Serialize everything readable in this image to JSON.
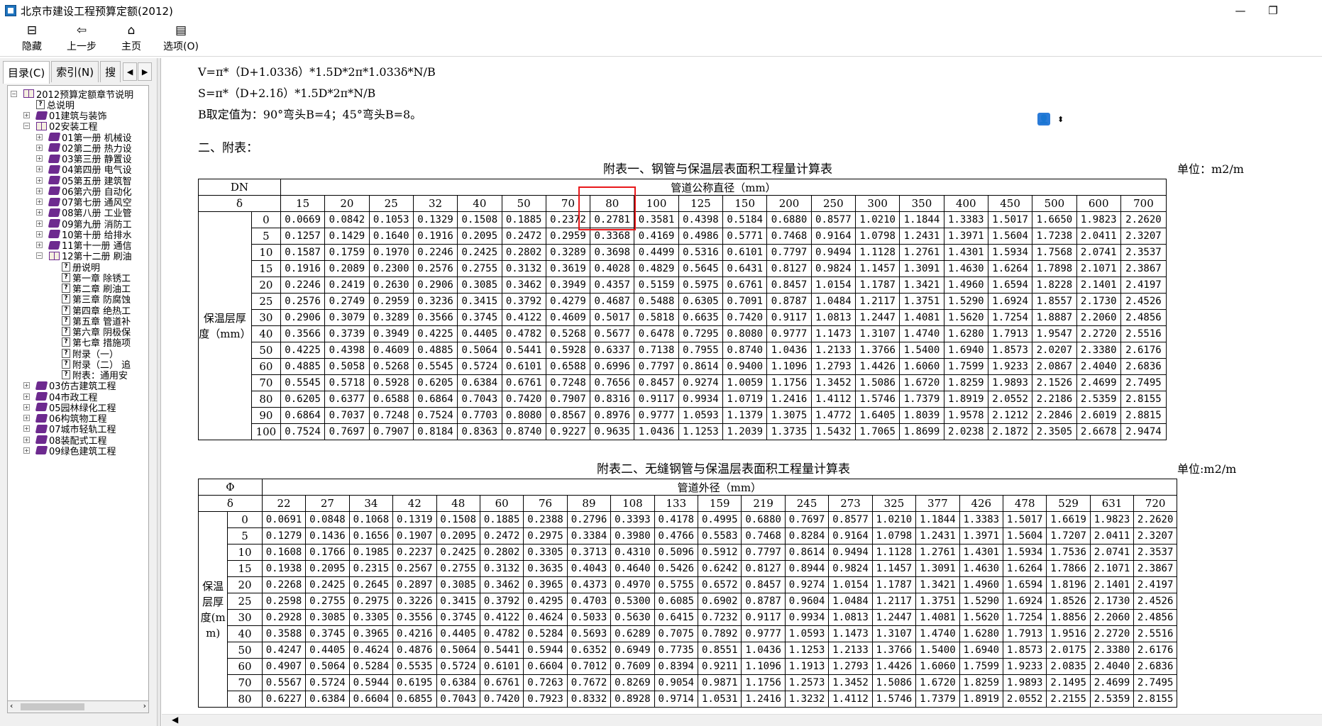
{
  "window": {
    "title": "北京市建设工程预算定额(2012)",
    "min": "—",
    "max": "❐"
  },
  "toolbar": {
    "hide": "隐藏",
    "back": "上一步",
    "home": "主页",
    "options": "选项(O)"
  },
  "tabs": {
    "contents": "目录(C)",
    "index": "索引(N)",
    "search": "搜",
    "prev": "◀",
    "next": "▶"
  },
  "tree": [
    {
      "label": "2012预算定额章节说明",
      "indent": 0,
      "exp": "−",
      "icon": "open"
    },
    {
      "label": "总说明",
      "indent": 1,
      "exp": "",
      "icon": "help"
    },
    {
      "label": "01建筑与装饰",
      "indent": 1,
      "exp": "+",
      "icon": "closed"
    },
    {
      "label": "02安装工程",
      "indent": 1,
      "exp": "−",
      "icon": "open"
    },
    {
      "label": "01第一册 机械设",
      "indent": 2,
      "exp": "+",
      "icon": "closed"
    },
    {
      "label": "02第二册 热力设",
      "indent": 2,
      "exp": "+",
      "icon": "closed"
    },
    {
      "label": "03第三册 静置设",
      "indent": 2,
      "exp": "+",
      "icon": "closed"
    },
    {
      "label": "04第四册 电气设",
      "indent": 2,
      "exp": "+",
      "icon": "closed"
    },
    {
      "label": "05第五册 建筑智",
      "indent": 2,
      "exp": "+",
      "icon": "closed"
    },
    {
      "label": "06第六册 自动化",
      "indent": 2,
      "exp": "+",
      "icon": "closed"
    },
    {
      "label": "07第七册 通风空",
      "indent": 2,
      "exp": "+",
      "icon": "closed"
    },
    {
      "label": "08第八册 工业管",
      "indent": 2,
      "exp": "+",
      "icon": "closed"
    },
    {
      "label": "09第九册 消防工",
      "indent": 2,
      "exp": "+",
      "icon": "closed"
    },
    {
      "label": "10第十册 给排水",
      "indent": 2,
      "exp": "+",
      "icon": "closed"
    },
    {
      "label": "11第十一册 通信",
      "indent": 2,
      "exp": "+",
      "icon": "closed"
    },
    {
      "label": "12第十二册 刷油",
      "indent": 2,
      "exp": "−",
      "icon": "open"
    },
    {
      "label": "册说明",
      "indent": 3,
      "exp": "",
      "icon": "help"
    },
    {
      "label": "第一章 除锈工",
      "indent": 3,
      "exp": "",
      "icon": "help"
    },
    {
      "label": "第二章 刷油工",
      "indent": 3,
      "exp": "",
      "icon": "help"
    },
    {
      "label": "第三章 防腐蚀",
      "indent": 3,
      "exp": "",
      "icon": "help"
    },
    {
      "label": "第四章 绝热工",
      "indent": 3,
      "exp": "",
      "icon": "help"
    },
    {
      "label": "第五章 管道补",
      "indent": 3,
      "exp": "",
      "icon": "help"
    },
    {
      "label": "第六章 阴极保",
      "indent": 3,
      "exp": "",
      "icon": "help"
    },
    {
      "label": "第七章 措施项",
      "indent": 3,
      "exp": "",
      "icon": "help"
    },
    {
      "label": "附录（一）",
      "indent": 3,
      "exp": "",
      "icon": "help"
    },
    {
      "label": "附录（二） 追",
      "indent": 3,
      "exp": "",
      "icon": "help"
    },
    {
      "label": "附表：通用安",
      "indent": 3,
      "exp": "",
      "icon": "help"
    },
    {
      "label": "03仿古建筑工程",
      "indent": 1,
      "exp": "+",
      "icon": "closed"
    },
    {
      "label": "04市政工程",
      "indent": 1,
      "exp": "+",
      "icon": "closed"
    },
    {
      "label": "05园林绿化工程",
      "indent": 1,
      "exp": "+",
      "icon": "closed"
    },
    {
      "label": "06构筑物工程",
      "indent": 1,
      "exp": "+",
      "icon": "closed"
    },
    {
      "label": "07城市轻轨工程",
      "indent": 1,
      "exp": "+",
      "icon": "closed"
    },
    {
      "label": "08装配式工程",
      "indent": 1,
      "exp": "+",
      "icon": "closed"
    },
    {
      "label": "09绿色建筑工程",
      "indent": 1,
      "exp": "+",
      "icon": "closed"
    }
  ],
  "content": {
    "formula_v": "V=π*（D+1.033δ）*1.5D*2π*1.033δ*N/B",
    "formula_s": "S=π*（D+2.1δ）*1.5D*2π*N/B",
    "formula_b": "B取定值为：90°弯头B=4；45°弯头B=8。",
    "section": "二、附表："
  },
  "table1": {
    "title": "附表一、钢管与保温层表面积工程量计算表",
    "unit": "单位：m2/m",
    "corner_top": "DN",
    "corner_bottom": "δ",
    "span_header": "管道公称直径（mm）",
    "row_label": "保温层厚度（mm）",
    "columns": [
      "15",
      "20",
      "25",
      "32",
      "40",
      "50",
      "70",
      "80",
      "100",
      "125",
      "150",
      "200",
      "250",
      "300",
      "350",
      "400",
      "450",
      "500",
      "600",
      "700"
    ],
    "rows": [
      {
        "d": "0",
        "v": [
          "0.0669",
          "0.0842",
          "0.1053",
          "0.1329",
          "0.1508",
          "0.1885",
          "0.2372",
          "0.2781",
          "0.3581",
          "0.4398",
          "0.5184",
          "0.6880",
          "0.8577",
          "1.0210",
          "1.1844",
          "1.3383",
          "1.5017",
          "1.6650",
          "1.9823",
          "2.2620"
        ]
      },
      {
        "d": "5",
        "v": [
          "0.1257",
          "0.1429",
          "0.1640",
          "0.1916",
          "0.2095",
          "0.2472",
          "0.2959",
          "0.3368",
          "0.4169",
          "0.4986",
          "0.5771",
          "0.7468",
          "0.9164",
          "1.0798",
          "1.2431",
          "1.3971",
          "1.5604",
          "1.7238",
          "2.0411",
          "2.3207"
        ]
      },
      {
        "d": "10",
        "v": [
          "0.1587",
          "0.1759",
          "0.1970",
          "0.2246",
          "0.2425",
          "0.2802",
          "0.3289",
          "0.3698",
          "0.4499",
          "0.5316",
          "0.6101",
          "0.7797",
          "0.9494",
          "1.1128",
          "1.2761",
          "1.4301",
          "1.5934",
          "1.7568",
          "2.0741",
          "2.3537"
        ]
      },
      {
        "d": "15",
        "v": [
          "0.1916",
          "0.2089",
          "0.2300",
          "0.2576",
          "0.2755",
          "0.3132",
          "0.3619",
          "0.4028",
          "0.4829",
          "0.5645",
          "0.6431",
          "0.8127",
          "0.9824",
          "1.1457",
          "1.3091",
          "1.4630",
          "1.6264",
          "1.7898",
          "2.1071",
          "2.3867"
        ]
      },
      {
        "d": "20",
        "v": [
          "0.2246",
          "0.2419",
          "0.2630",
          "0.2906",
          "0.3085",
          "0.3462",
          "0.3949",
          "0.4357",
          "0.5159",
          "0.5975",
          "0.6761",
          "0.8457",
          "1.0154",
          "1.1787",
          "1.3421",
          "1.4960",
          "1.6594",
          "1.8228",
          "2.1401",
          "2.4197"
        ]
      },
      {
        "d": "25",
        "v": [
          "0.2576",
          "0.2749",
          "0.2959",
          "0.3236",
          "0.3415",
          "0.3792",
          "0.4279",
          "0.4687",
          "0.5488",
          "0.6305",
          "0.7091",
          "0.8787",
          "1.0484",
          "1.2117",
          "1.3751",
          "1.5290",
          "1.6924",
          "1.8557",
          "2.1730",
          "2.4526"
        ]
      },
      {
        "d": "30",
        "v": [
          "0.2906",
          "0.3079",
          "0.3289",
          "0.3566",
          "0.3745",
          "0.4122",
          "0.4609",
          "0.5017",
          "0.5818",
          "0.6635",
          "0.7420",
          "0.9117",
          "1.0813",
          "1.2447",
          "1.4081",
          "1.5620",
          "1.7254",
          "1.8887",
          "2.2060",
          "2.4856"
        ]
      },
      {
        "d": "40",
        "v": [
          "0.3566",
          "0.3739",
          "0.3949",
          "0.4225",
          "0.4405",
          "0.4782",
          "0.5268",
          "0.5677",
          "0.6478",
          "0.7295",
          "0.8080",
          "0.9777",
          "1.1473",
          "1.3107",
          "1.4740",
          "1.6280",
          "1.7913",
          "1.9547",
          "2.2720",
          "2.5516"
        ]
      },
      {
        "d": "50",
        "v": [
          "0.4225",
          "0.4398",
          "0.4609",
          "0.4885",
          "0.5064",
          "0.5441",
          "0.5928",
          "0.6337",
          "0.7138",
          "0.7955",
          "0.8740",
          "1.0436",
          "1.2133",
          "1.3766",
          "1.5400",
          "1.6940",
          "1.8573",
          "2.0207",
          "2.3380",
          "2.6176"
        ]
      },
      {
        "d": "60",
        "v": [
          "0.4885",
          "0.5058",
          "0.5268",
          "0.5545",
          "0.5724",
          "0.6101",
          "0.6588",
          "0.6996",
          "0.7797",
          "0.8614",
          "0.9400",
          "1.1096",
          "1.2793",
          "1.4426",
          "1.6060",
          "1.7599",
          "1.9233",
          "2.0867",
          "2.4040",
          "2.6836"
        ]
      },
      {
        "d": "70",
        "v": [
          "0.5545",
          "0.5718",
          "0.5928",
          "0.6205",
          "0.6384",
          "0.6761",
          "0.7248",
          "0.7656",
          "0.8457",
          "0.9274",
          "1.0059",
          "1.1756",
          "1.3452",
          "1.5086",
          "1.6720",
          "1.8259",
          "1.9893",
          "2.1526",
          "2.4699",
          "2.7495"
        ]
      },
      {
        "d": "80",
        "v": [
          "0.6205",
          "0.6377",
          "0.6588",
          "0.6864",
          "0.7043",
          "0.7420",
          "0.7907",
          "0.8316",
          "0.9117",
          "0.9934",
          "1.0719",
          "1.2416",
          "1.4112",
          "1.5746",
          "1.7379",
          "1.8919",
          "2.0552",
          "2.2186",
          "2.5359",
          "2.8155"
        ]
      },
      {
        "d": "90",
        "v": [
          "0.6864",
          "0.7037",
          "0.7248",
          "0.7524",
          "0.7703",
          "0.8080",
          "0.8567",
          "0.8976",
          "0.9777",
          "1.0593",
          "1.1379",
          "1.3075",
          "1.4772",
          "1.6405",
          "1.8039",
          "1.9578",
          "2.1212",
          "2.2846",
          "2.6019",
          "2.8815"
        ]
      },
      {
        "d": "100",
        "v": [
          "0.7524",
          "0.7697",
          "0.7907",
          "0.8184",
          "0.8363",
          "0.8740",
          "0.9227",
          "0.9635",
          "1.0436",
          "1.1253",
          "1.2039",
          "1.3735",
          "1.5432",
          "1.7065",
          "1.8699",
          "2.0238",
          "2.1872",
          "2.3505",
          "2.6678",
          "2.9474"
        ]
      }
    ]
  },
  "table2": {
    "title": "附表二、无缝钢管与保温层表面积工程量计算表",
    "unit": "单位:m2/m",
    "corner_top": "Φ",
    "corner_bottom": "δ",
    "span_header": "管道外径（mm）",
    "row_label": "保温层厚度(mm)",
    "columns": [
      "22",
      "27",
      "34",
      "42",
      "48",
      "60",
      "76",
      "89",
      "108",
      "133",
      "159",
      "219",
      "245",
      "273",
      "325",
      "377",
      "426",
      "478",
      "529",
      "631",
      "720"
    ],
    "rows": [
      {
        "d": "0",
        "v": [
          "0.0691",
          "0.0848",
          "0.1068",
          "0.1319",
          "0.1508",
          "0.1885",
          "0.2388",
          "0.2796",
          "0.3393",
          "0.4178",
          "0.4995",
          "0.6880",
          "0.7697",
          "0.8577",
          "1.0210",
          "1.1844",
          "1.3383",
          "1.5017",
          "1.6619",
          "1.9823",
          "2.2620"
        ]
      },
      {
        "d": "5",
        "v": [
          "0.1279",
          "0.1436",
          "0.1656",
          "0.1907",
          "0.2095",
          "0.2472",
          "0.2975",
          "0.3384",
          "0.3980",
          "0.4766",
          "0.5583",
          "0.7468",
          "0.8284",
          "0.9164",
          "1.0798",
          "1.2431",
          "1.3971",
          "1.5604",
          "1.7207",
          "2.0411",
          "2.3207"
        ]
      },
      {
        "d": "10",
        "v": [
          "0.1608",
          "0.1766",
          "0.1985",
          "0.2237",
          "0.2425",
          "0.2802",
          "0.3305",
          "0.3713",
          "0.4310",
          "0.5096",
          "0.5912",
          "0.7797",
          "0.8614",
          "0.9494",
          "1.1128",
          "1.2761",
          "1.4301",
          "1.5934",
          "1.7536",
          "2.0741",
          "2.3537"
        ]
      },
      {
        "d": "15",
        "v": [
          "0.1938",
          "0.2095",
          "0.2315",
          "0.2567",
          "0.2755",
          "0.3132",
          "0.3635",
          "0.4043",
          "0.4640",
          "0.5426",
          "0.6242",
          "0.8127",
          "0.8944",
          "0.9824",
          "1.1457",
          "1.3091",
          "1.4630",
          "1.6264",
          "1.7866",
          "2.1071",
          "2.3867"
        ]
      },
      {
        "d": "20",
        "v": [
          "0.2268",
          "0.2425",
          "0.2645",
          "0.2897",
          "0.3085",
          "0.3462",
          "0.3965",
          "0.4373",
          "0.4970",
          "0.5755",
          "0.6572",
          "0.8457",
          "0.9274",
          "1.0154",
          "1.1787",
          "1.3421",
          "1.4960",
          "1.6594",
          "1.8196",
          "2.1401",
          "2.4197"
        ]
      },
      {
        "d": "25",
        "v": [
          "0.2598",
          "0.2755",
          "0.2975",
          "0.3226",
          "0.3415",
          "0.3792",
          "0.4295",
          "0.4703",
          "0.5300",
          "0.6085",
          "0.6902",
          "0.8787",
          "0.9604",
          "1.0484",
          "1.2117",
          "1.3751",
          "1.5290",
          "1.6924",
          "1.8526",
          "2.1730",
          "2.4526"
        ]
      },
      {
        "d": "30",
        "v": [
          "0.2928",
          "0.3085",
          "0.3305",
          "0.3556",
          "0.3745",
          "0.4122",
          "0.4624",
          "0.5033",
          "0.5630",
          "0.6415",
          "0.7232",
          "0.9117",
          "0.9934",
          "1.0813",
          "1.2447",
          "1.4081",
          "1.5620",
          "1.7254",
          "1.8856",
          "2.2060",
          "2.4856"
        ]
      },
      {
        "d": "40",
        "v": [
          "0.3588",
          "0.3745",
          "0.3965",
          "0.4216",
          "0.4405",
          "0.4782",
          "0.5284",
          "0.5693",
          "0.6289",
          "0.7075",
          "0.7892",
          "0.9777",
          "1.0593",
          "1.1473",
          "1.3107",
          "1.4740",
          "1.6280",
          "1.7913",
          "1.9516",
          "2.2720",
          "2.5516"
        ]
      },
      {
        "d": "50",
        "v": [
          "0.4247",
          "0.4405",
          "0.4624",
          "0.4876",
          "0.5064",
          "0.5441",
          "0.5944",
          "0.6352",
          "0.6949",
          "0.7735",
          "0.8551",
          "1.0436",
          "1.1253",
          "1.2133",
          "1.3766",
          "1.5400",
          "1.6940",
          "1.8573",
          "2.0175",
          "2.3380",
          "2.6176"
        ]
      },
      {
        "d": "60",
        "v": [
          "0.4907",
          "0.5064",
          "0.5284",
          "0.5535",
          "0.5724",
          "0.6101",
          "0.6604",
          "0.7012",
          "0.7609",
          "0.8394",
          "0.9211",
          "1.1096",
          "1.1913",
          "1.2793",
          "1.4426",
          "1.6060",
          "1.7599",
          "1.9233",
          "2.0835",
          "2.4040",
          "2.6836"
        ]
      },
      {
        "d": "70",
        "v": [
          "0.5567",
          "0.5724",
          "0.5944",
          "0.6195",
          "0.6384",
          "0.6761",
          "0.7263",
          "0.7672",
          "0.8269",
          "0.9054",
          "0.9871",
          "1.1756",
          "1.2573",
          "1.3452",
          "1.5086",
          "1.6720",
          "1.8259",
          "1.9893",
          "2.1495",
          "2.4699",
          "2.7495"
        ]
      },
      {
        "d": "80",
        "v": [
          "0.6227",
          "0.6384",
          "0.6604",
          "0.6855",
          "0.7043",
          "0.7420",
          "0.7923",
          "0.8332",
          "0.8928",
          "0.9714",
          "1.0531",
          "1.2416",
          "1.3232",
          "1.4112",
          "1.5746",
          "1.7379",
          "1.8919",
          "2.0552",
          "2.2155",
          "2.5359",
          "2.8155"
        ]
      }
    ]
  },
  "scroll": {
    "left": "◀",
    "right": "▶",
    "tree_left": "‹",
    "tree_right": "›"
  },
  "colors": {
    "highlight": "#e8181b",
    "book": "#6d2a8f"
  }
}
